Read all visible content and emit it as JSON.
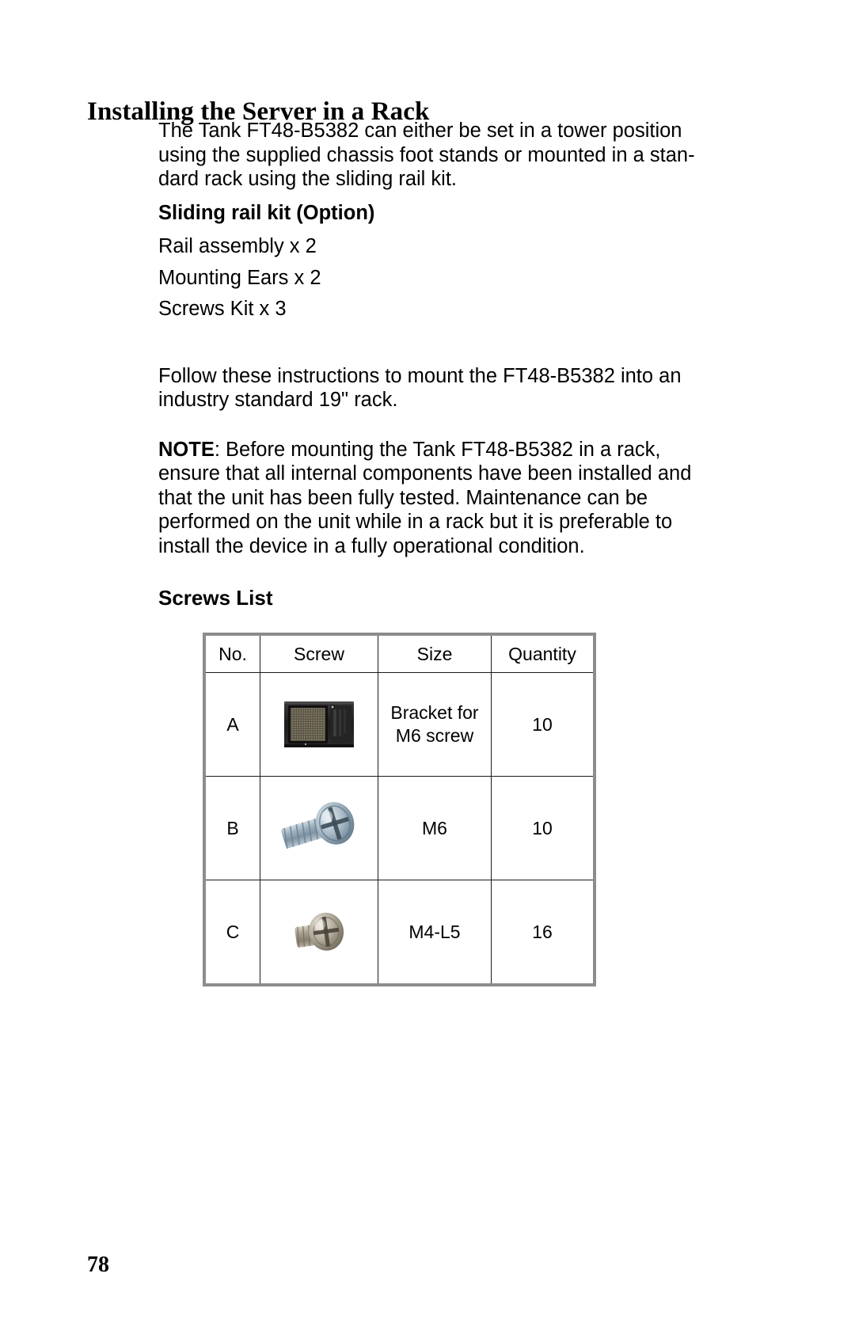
{
  "document": {
    "heading": "Installing the Server in a Rack",
    "page_number": "78"
  },
  "intro_paragraph": {
    "line1": "The Tank FT48-B5382 can either be set in a tower position",
    "line2": "using the supplied chassis foot stands or mounted in a stan-",
    "line3": "dard rack using the sliding rail kit."
  },
  "rail_kit": {
    "subheading": "Sliding rail kit (Option)",
    "items": [
      "Rail assembly x 2",
      "Mounting Ears x 2",
      "Screws Kit x 3"
    ]
  },
  "instructions_paragraph": {
    "line1": "Follow these instructions to mount the FT48-B5382 into an",
    "line2": "industry standard 19\" rack."
  },
  "note": {
    "label": "NOTE",
    "line1": ": Before mounting the Tank FT48-B5382 in a rack,",
    "line2": "ensure that all internal components have been installed and",
    "line3": "that the unit has been fully tested. Maintenance can be",
    "line4": "performed on the unit while in a rack but it is preferable to",
    "line5": "install the device in a fully operational condition."
  },
  "screws_list": {
    "heading": "Screws List",
    "table": {
      "columns": [
        "No.",
        "Screw",
        "Size",
        "Quantity"
      ],
      "rows": [
        {
          "no": "A",
          "screw_image": "rack-bracket-nut-image",
          "size_line1": "Bracket for",
          "size_line2": "M6 screw",
          "quantity": "10"
        },
        {
          "no": "B",
          "screw_image": "m6-pan-head-screw-image",
          "size_line1": "M6",
          "size_line2": "",
          "quantity": "10"
        },
        {
          "no": "C",
          "screw_image": "m4-l5-pan-head-screw-image",
          "size_line1": "M4-L5",
          "size_line2": "",
          "quantity": "16"
        }
      ]
    }
  },
  "colors": {
    "text": "#000000",
    "table_outer_border": "#8c8c8c",
    "table_inner_border": "#1a1a1a",
    "page_background": "#ffffff"
  }
}
